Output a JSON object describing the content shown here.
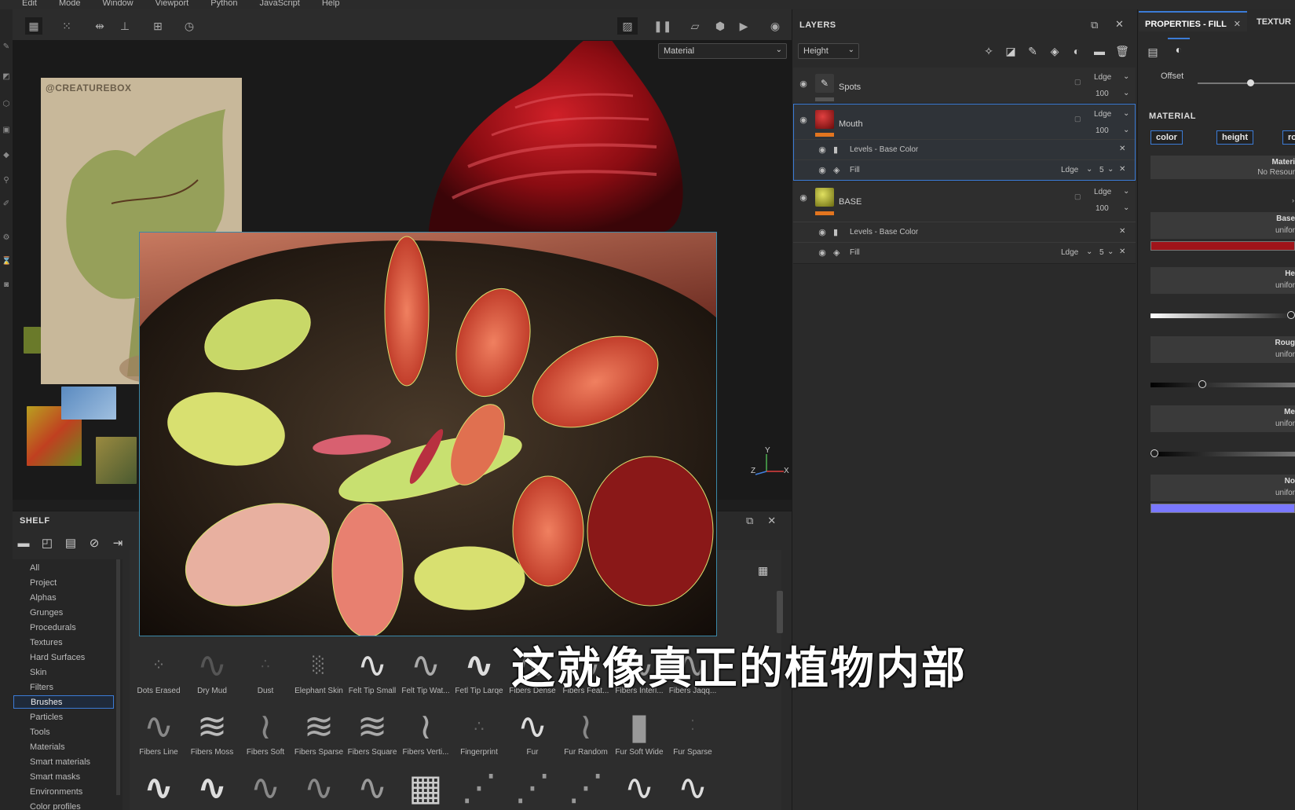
{
  "menu": [
    "Edit",
    "Mode",
    "Window",
    "Viewport",
    "Python",
    "JavaScript",
    "Help"
  ],
  "viewport": {
    "material_select": "Material",
    "ref_watermark": "@CREATUREBOX",
    "axes": {
      "y": "Y",
      "x": "X",
      "z": "Z"
    }
  },
  "layers": {
    "title": "LAYERS",
    "channel": "Height",
    "items": [
      {
        "name": "Spots",
        "blend": "Ldge",
        "opacity": "100"
      },
      {
        "name": "Mouth",
        "blend": "Ldge",
        "opacity": "100",
        "effects": [
          {
            "name": "Levels - Base Color"
          },
          {
            "name": "Fill",
            "blend": "Ldge",
            "value": "5"
          }
        ]
      },
      {
        "name": "BASE",
        "blend": "Ldge",
        "opacity": "100",
        "effects": [
          {
            "name": "Levels - Base Color"
          },
          {
            "name": "Fill",
            "blend": "Ldge",
            "value": "5"
          }
        ]
      }
    ]
  },
  "properties": {
    "tab": "PROPERTIES - FILL",
    "tab2": "TEXTUR",
    "offset_label": "Offset",
    "offset_value": 0.55,
    "section": "MATERIAL",
    "channels": [
      "color",
      "height",
      "ro"
    ],
    "material_label": "Materi",
    "material_value": "No Resour",
    "base_label": "Base",
    "base_value": "unifor",
    "base_color": "#a0141a",
    "height_label": "He",
    "height_value": "unifor",
    "height_level": 1.0,
    "rough_label": "Roug",
    "rough_value": "unifor",
    "rough_level": 0.35,
    "metal_label": "Me",
    "metal_value": "unifor",
    "metal_level": 0.0,
    "normal_label": "No",
    "normal_value": "unifor",
    "normal_color": "#7a78ff"
  },
  "shelf": {
    "title": "SHELF",
    "categories": [
      "All",
      "Project",
      "Alphas",
      "Grunges",
      "Procedurals",
      "Textures",
      "Hard Surfaces",
      "Skin",
      "Filters",
      "Brushes",
      "Particles",
      "Tools",
      "Materials",
      "Smart materials",
      "Smart masks",
      "Environments",
      "Color profiles"
    ],
    "active": "Brushes",
    "row1": [
      "Dots Erased",
      "Dry Mud",
      "Dust",
      "Elephant Skin",
      "Felt Tip Small",
      "Felt Tip Wat...",
      "Fetl Tip Larqe",
      "Fibers Dense",
      "Fibers Feat...",
      "Fibers Interl...",
      "Fibers Jaqq..."
    ],
    "row2": [
      "Fibers Line",
      "Fibers Moss",
      "Fibers Soft",
      "Fibers Sparse",
      "Fibers Square",
      "Fibers Verti...",
      "Fingerprint",
      "Fur",
      "Fur Random",
      "Fur Soft Wide",
      "Fur Sparse"
    ]
  },
  "subtitle": "这就像真正的植物内部"
}
